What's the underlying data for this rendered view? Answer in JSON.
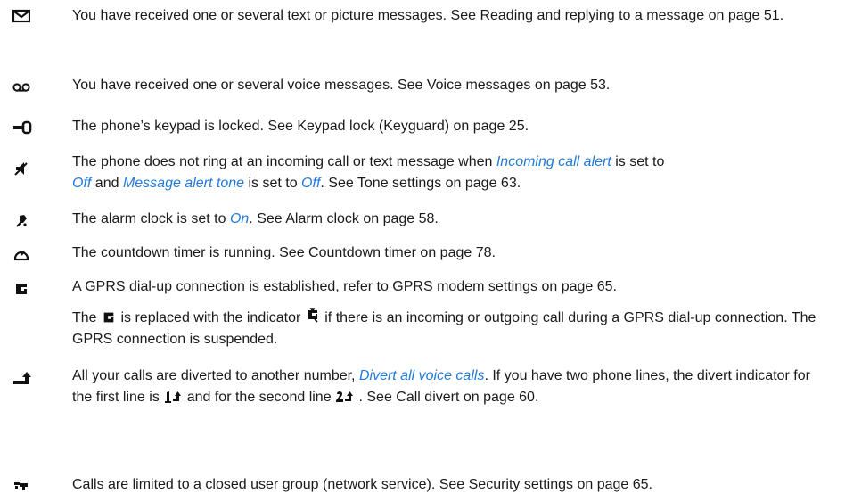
{
  "entries": [
    {
      "icon": "envelope-icon",
      "text": "You have received one or several text or picture messages. See Reading and replying to a message on page 51."
    },
    {
      "icon": "voicemail-icon",
      "text": "You have received one or several voice messages. See Voice messages on page 53."
    },
    {
      "icon": "key-icon",
      "text": "The phone’s keypad is locked. See Keypad lock (Keyguard) on page 25."
    },
    {
      "icon": "silent-speaker-icon",
      "p1": "The phone does not ring at an incoming call or text message when ",
      "s1": "Incoming call alert",
      "p2": " is set to ",
      "s2": "Off",
      "p3": " and ",
      "s3": "Message alert tone",
      "p4": " is set to ",
      "s4": "Off",
      "p5": ". See Tone settings on page 63."
    },
    {
      "icon": "alarm-clock-icon",
      "p1": "The alarm clock is set to ",
      "s1": "On",
      "p2": ". See Alarm clock on page 58."
    },
    {
      "icon": "countdown-timer-icon",
      "text": "The countdown timer is running. See Countdown timer on page 78."
    },
    {
      "icon": "gprs-icon",
      "text": "A GPRS dial-up connection is established, refer to GPRS modem settings on page 65.",
      "note_p1": "The ",
      "note_p2": " is replaced with the indicator ",
      "note_p3": "  if there is an incoming or outgoing call during a GPRS dial-up connection. The GPRS connection is suspended."
    },
    {
      "icon": "call-divert-icon",
      "p1": "All your calls are diverted to another number, ",
      "s1": "Divert all voice calls",
      "p2": ". If you have two phone lines, the divert indicator for the first line is ",
      "p3": "  and for the second line ",
      "p4": " . See Call divert on page 60."
    },
    {
      "icon": "closed-user-group-icon",
      "text": "Calls are limited to a closed user group (network service). See Security settings on page 65."
    }
  ]
}
